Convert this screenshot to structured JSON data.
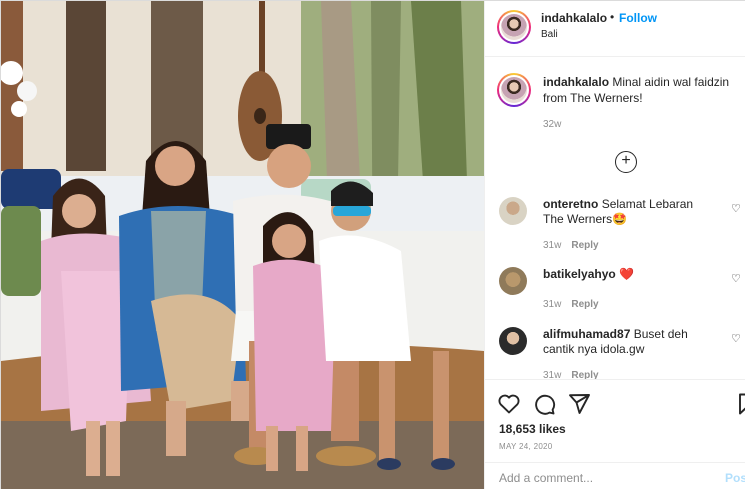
{
  "header": {
    "username": "indahkalalo",
    "separator": "•",
    "follow_label": "Follow",
    "location": "Bali"
  },
  "caption": {
    "username": "indahkalalo",
    "text": "Minal aidin wal faidzin from The Werners!",
    "time": "32w"
  },
  "load_more_icon": "plus-circle-icon",
  "comments": [
    {
      "username": "onteretno",
      "text": "Selamat Lebaran The Werners🤩",
      "time": "31w",
      "reply_label": "Reply",
      "avatar_color": "#d9d3c4"
    },
    {
      "username": "batikelyahyo",
      "text": "❤️",
      "time": "31w",
      "reply_label": "Reply",
      "avatar_color": "#8f7a5a"
    },
    {
      "username": "alifmuhamad87",
      "text": "Buset deh cantik nya idola.gw",
      "time": "31w",
      "reply_label": "Reply",
      "avatar_color": "#2b2b2b"
    }
  ],
  "actions": {
    "icons": [
      "heart-icon",
      "comment-icon",
      "share-icon",
      "bookmark-icon"
    ],
    "likes": "18,653 likes",
    "date": "MAY 24, 2020"
  },
  "add_comment": {
    "placeholder": "Add a comment...",
    "post_label": "Post"
  },
  "colors": {
    "link_blue": "#0095f6",
    "muted_gray": "#8e8e8e",
    "like_red": "#ed4956",
    "post_disabled": "#b2dffc"
  }
}
